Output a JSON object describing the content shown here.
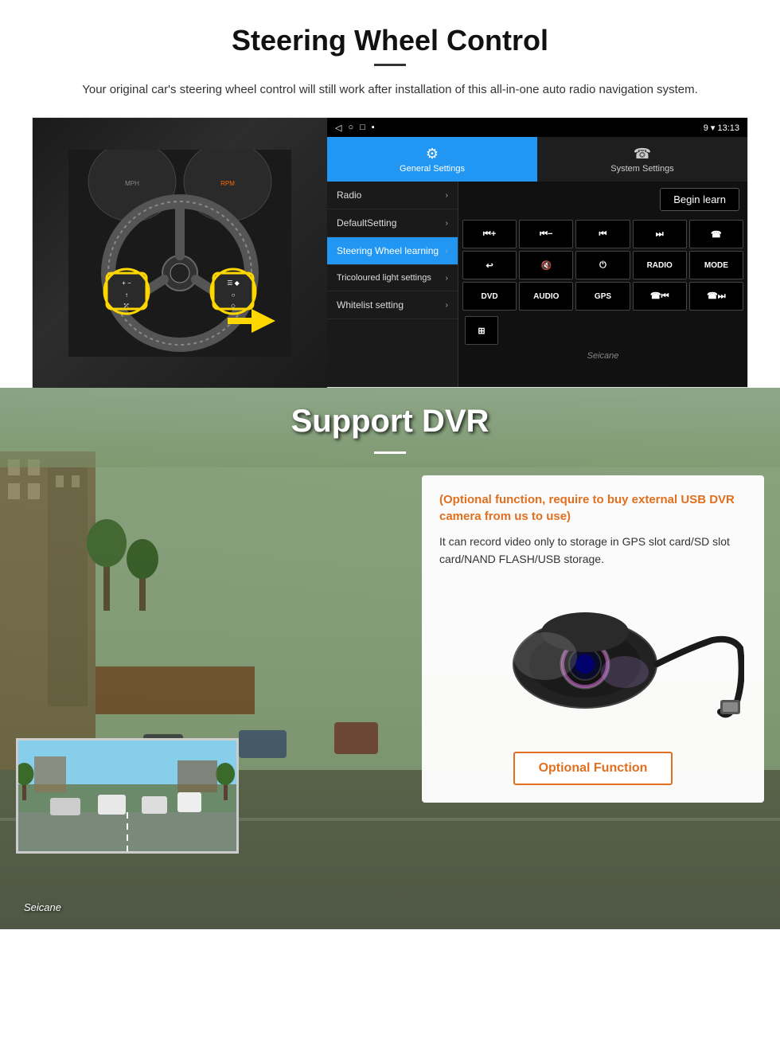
{
  "section1": {
    "title": "Steering Wheel Control",
    "subtitle": "Your original car's steering wheel control will still work after installation of this all-in-one auto radio navigation system.",
    "android_ui": {
      "status_bar": {
        "icons": [
          "◁",
          "○",
          "□",
          "▪"
        ],
        "right_text": "9 ▾ 13:13"
      },
      "tabs": [
        {
          "label": "General Settings",
          "icon": "⚙",
          "active": true
        },
        {
          "label": "System Settings",
          "icon": "☎",
          "active": false
        }
      ],
      "menu_items": [
        {
          "label": "Radio",
          "active": false
        },
        {
          "label": "DefaultSetting",
          "active": false
        },
        {
          "label": "Steering Wheel learning",
          "active": true
        },
        {
          "label": "Tricoloured light settings",
          "active": false
        },
        {
          "label": "Whitelist setting",
          "active": false
        }
      ],
      "begin_learn_label": "Begin learn",
      "control_buttons": [
        {
          "label": "⏮+",
          "row": 1
        },
        {
          "label": "⏮-",
          "row": 1
        },
        {
          "label": "⏮",
          "row": 1
        },
        {
          "label": "⏭",
          "row": 1
        },
        {
          "label": "☎",
          "row": 1
        },
        {
          "label": "↩",
          "row": 2
        },
        {
          "label": "🔇",
          "row": 2
        },
        {
          "label": "⏻",
          "row": 2
        },
        {
          "label": "RADIO",
          "row": 2
        },
        {
          "label": "MODE",
          "row": 2
        },
        {
          "label": "DVD",
          "row": 3
        },
        {
          "label": "AUDIO",
          "row": 3
        },
        {
          "label": "GPS",
          "row": 3
        },
        {
          "label": "☎⏮",
          "row": 3
        },
        {
          "label": "☎⏭",
          "row": 3
        }
      ],
      "whitelist_icon": "⊞",
      "watermark": "Seicane"
    }
  },
  "section2": {
    "title": "Support DVR",
    "info_card": {
      "optional_text": "(Optional function, require to buy external USB DVR camera from us to use)",
      "desc_text": "It can record video only to storage in GPS slot card/SD slot card/NAND FLASH/USB storage."
    },
    "optional_function_label": "Optional Function",
    "watermark": "Seicane"
  }
}
